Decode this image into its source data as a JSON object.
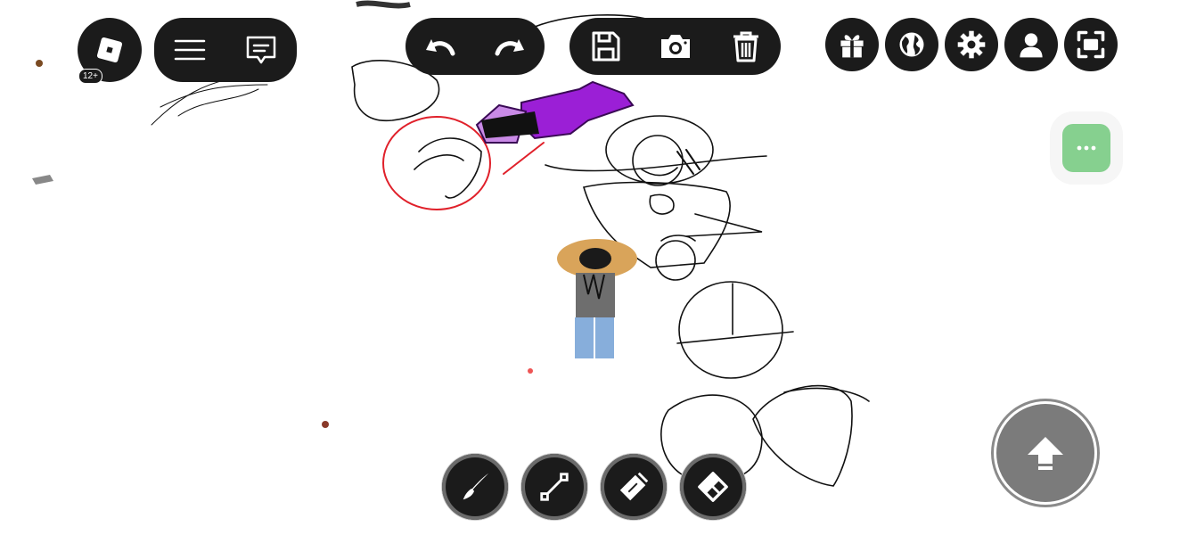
{
  "roblox_menu": {
    "icon": "roblox-logo-icon",
    "age_rating": "12+"
  },
  "left_pill": {
    "icons": [
      "hamburger-menu-icon",
      "chat-icon"
    ]
  },
  "history_pill": {
    "icons": [
      "undo-icon",
      "redo-icon"
    ]
  },
  "file_pill": {
    "icons": [
      "save-icon",
      "camera-icon",
      "trash-icon"
    ]
  },
  "right_buttons": [
    "gift-icon",
    "globe-icon",
    "gear-icon",
    "profile-icon",
    "fullscreen-icon"
  ],
  "more_button": {
    "icon": "more-dots-icon",
    "color": "#86d08f"
  },
  "tools": [
    "brush-icon",
    "line-tool-icon",
    "spray-can-icon",
    "eraser-icon"
  ],
  "jump_button": {
    "icon": "jump-arrow-icon"
  },
  "colors": {
    "ui_dark": "#1b1b1b",
    "accent_green": "#86d08f",
    "jump_gray": "#7b7b7b"
  }
}
